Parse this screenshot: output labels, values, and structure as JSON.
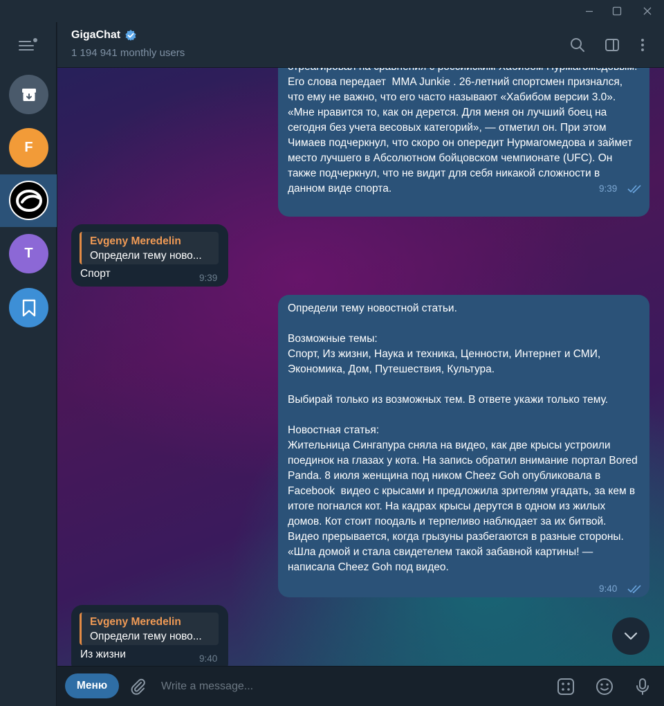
{
  "window": {
    "minimize_label": "–",
    "maximize_label": "☐",
    "close_label": "✕"
  },
  "sidebar": {
    "chats": [
      {
        "name": "archive",
        "icon": "archive-icon",
        "color": "#4a5a6b"
      },
      {
        "name": "F",
        "letter": "F",
        "color": "#f29b38"
      },
      {
        "name": "GigaChat",
        "icon": "gigachat-logo",
        "color": "#000000",
        "active": true
      },
      {
        "name": "T",
        "letter": "T",
        "color": "#8c68d6"
      },
      {
        "name": "saved",
        "icon": "bookmark-icon",
        "color": "#3d8fd6"
      }
    ]
  },
  "header": {
    "title": "GigaChat",
    "subtitle": "1 194 941 monthly users"
  },
  "messages": [
    {
      "id": "m1",
      "direction": "out",
      "text": "отреагировал на сравнения с российским Хабибом Нурмагомедовым. Его слова передает  MMA Junkie . 26-летний спортсмен признался, что ему не важно, что его часто называют «Хабибом версии 3.0». «Мне нравится то, как он дерется. Для меня он лучший боец на сегодня без учета весовых категорий», — отметил он. При этом Чимаев подчеркнул, что скоро он опередит Нурмагомедова и займет место лучшего в Абсолютном бойцовском чемпионате (UFC). Он также подчеркнул, что не видит для себя никакой сложности в данном виде спорта.",
      "time": "9:39"
    },
    {
      "id": "m2",
      "direction": "in",
      "reply_name": "Evgeny Meredelin",
      "reply_text": "Определи тему ново...",
      "text": "Спорт",
      "time": "9:39"
    },
    {
      "id": "m3",
      "direction": "out",
      "text": "Определи тему новостной статьи.\n\nВозможные темы:\nСпорт, Из жизни, Наука и техника, Ценности, Интернет и СМИ, Экономика, Дом, Путешествия, Культура.\n\nВыбирай только из возможных тем. В ответе укажи только тему.\n\nНовостная статья:\nЖительница Сингапура сняла на видео, как две крысы устроили поединок на глазах у кота. На запись обратил внимание портал Bored Panda. 8 июля женщина под ником Cheez Goh опубликовала в  Facebook  видео с крысами и предложила зрителям угадать, за кем в итоге погнался кот. На кадрах крысы дерутся в одном из жилых домов. Кот стоит поодаль и терпеливо наблюдает за их битвой. Видео прерывается, когда грызуны разбегаются в разные стороны. «Шла домой и стала свидетелем такой забавной картины! — написала Cheez Goh под видео.",
      "time": "9:40"
    },
    {
      "id": "m4",
      "direction": "in",
      "reply_name": "Evgeny Meredelin",
      "reply_text": "Определи тему ново...",
      "text": "Из жизни",
      "time": "9:40"
    }
  ],
  "composer": {
    "menu_label": "Меню",
    "placeholder": "Write a message..."
  },
  "colors": {
    "accent": "#2f6ea5",
    "outgoing_bubble": "#2b5278",
    "incoming_bubble": "#182533",
    "reply_name": "#f09a55",
    "verified": "#5aa6e8"
  }
}
